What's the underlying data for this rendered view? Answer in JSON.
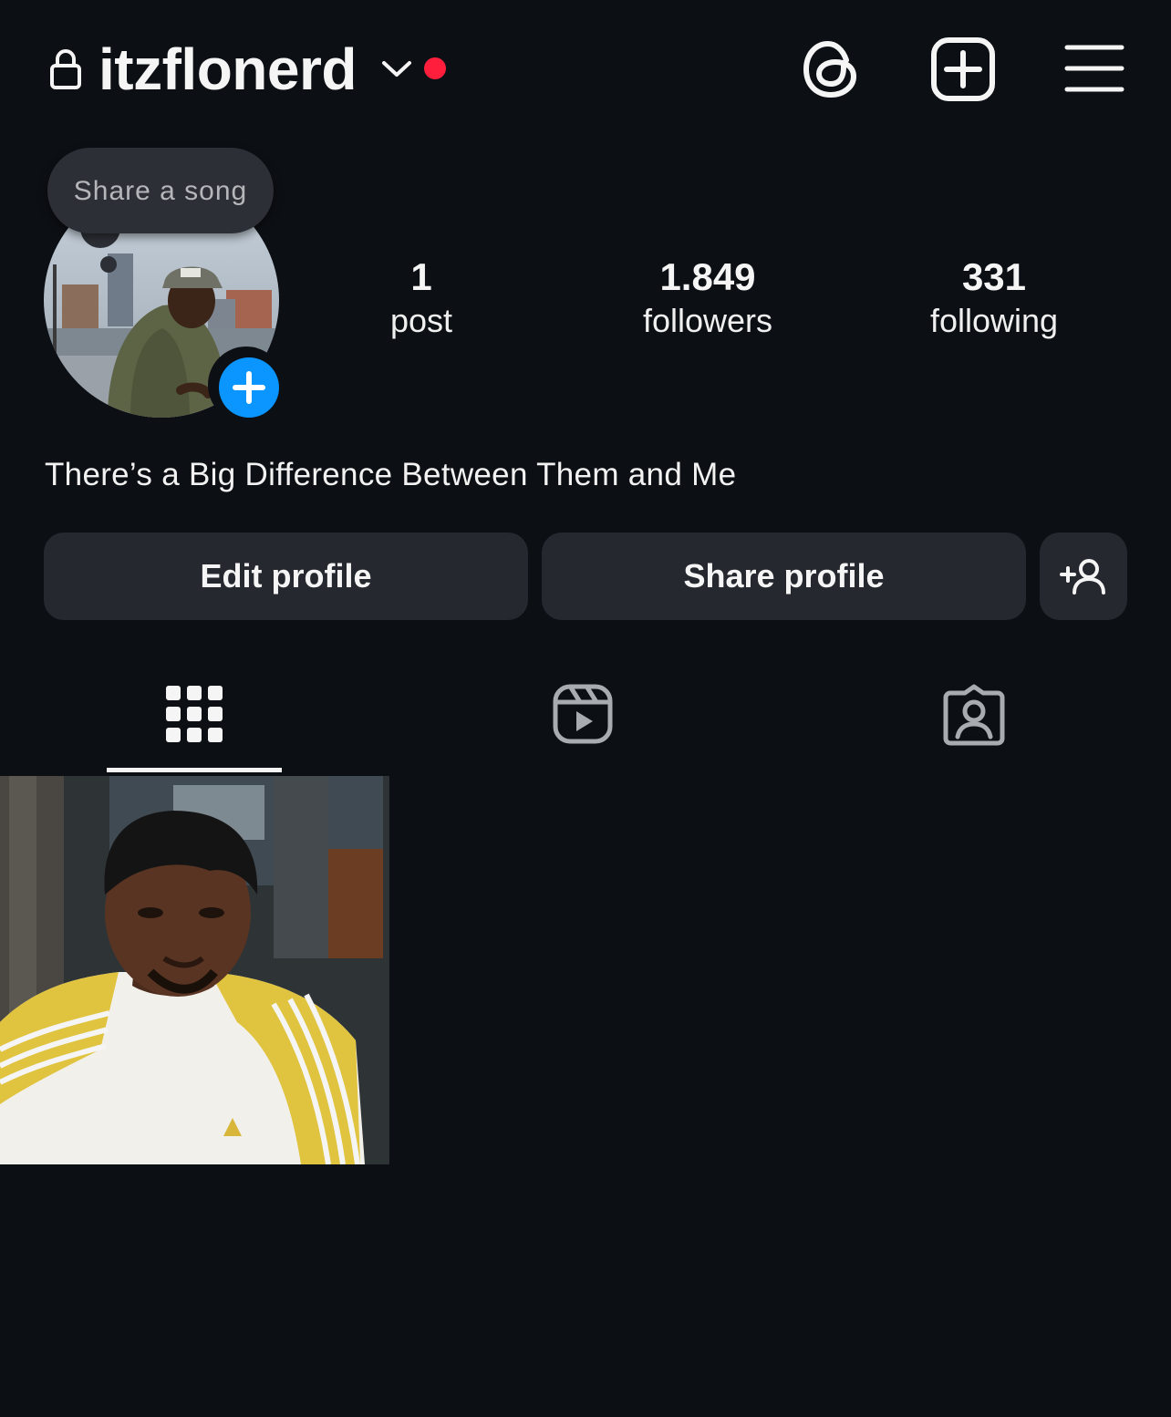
{
  "header": {
    "username": "itzflonerd",
    "icons": [
      "lock-icon",
      "chevron-down-icon",
      "threads-icon",
      "create-plus-icon",
      "menu-icon"
    ]
  },
  "note": {
    "placeholder": "Share a song"
  },
  "stats": {
    "posts": {
      "value": "1",
      "label": "post"
    },
    "followers": {
      "value": "1.849",
      "label": "followers"
    },
    "following": {
      "value": "331",
      "label": "following"
    }
  },
  "bio": "There’s a Big Difference Between Them and Me",
  "actions": {
    "edit_label": "Edit profile",
    "share_label": "Share profile"
  },
  "tabs": [
    {
      "icon": "grid-icon",
      "selected": true
    },
    {
      "icon": "reels-icon",
      "selected": false
    },
    {
      "icon": "tagged-icon",
      "selected": false
    }
  ],
  "colors": {
    "background": "#0c0f14",
    "button": "#25282e",
    "accent_blue": "#0a95ff",
    "notification_red": "#ff1f3d"
  }
}
